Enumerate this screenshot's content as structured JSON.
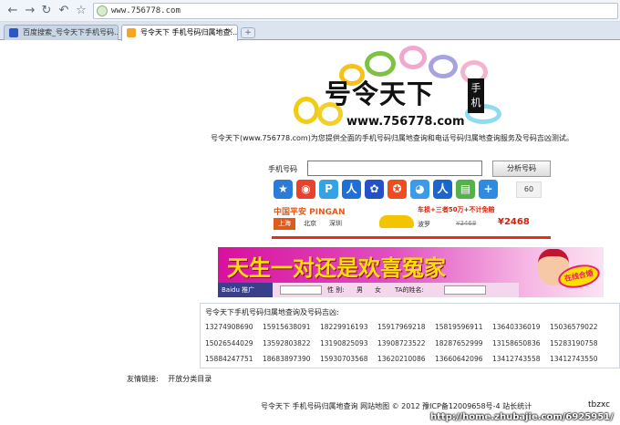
{
  "browser": {
    "url": "www.756778.com",
    "tabs": [
      {
        "title": "百度搜索_号令天下手机号码..."
      },
      {
        "title": "号令天下 手机号码归属地查..."
      }
    ],
    "icons": [
      "back-icon",
      "forward-icon",
      "reload-icon",
      "undo-icon",
      "star-icon",
      "close-icon",
      "new-tab-icon"
    ]
  },
  "logo": {
    "title": "号令天下",
    "sub": "手机",
    "domain": "www.756778.com"
  },
  "intro": "号令天下(www.756778.com)为您提供全面的手机号码归属地查询和电话号码归属地查询服务及号码吉凶测试。",
  "search": {
    "label": "手机号码",
    "value": "",
    "button": "分析号码"
  },
  "apps": {
    "icons": [
      "star-app-icon",
      "weibo-icon",
      "pps-icon",
      "renren-icon",
      "baidu-paw-icon",
      "game-icon",
      "qq-icon",
      "renren2-icon",
      "map-icon",
      "plus-icon"
    ],
    "count": "60"
  },
  "ad_pingan": {
    "brand": "中国平安 PINGAN",
    "cities": [
      "上海",
      "北京",
      "深圳"
    ],
    "offer": "车损+三者50万+不计免赔",
    "model": "波罗",
    "old_price": "¥3468",
    "new_price": "¥2468",
    "colors": {
      "brand": "#e05a1c",
      "price": "#d81e06"
    }
  },
  "ad_match": {
    "slogan": "天生一对还是欢喜冤家",
    "baidu": "Baidu 推广",
    "fields": [
      "性 别:",
      "男",
      "女",
      "TA的姓名:"
    ],
    "badge": "在线合婚"
  },
  "numbers_box": {
    "title": "号令天下手机号码归属地查询及号码吉凶:",
    "rows": [
      [
        "13274908690",
        "15915638091",
        "18229916193",
        "15917969218",
        "15819596911",
        "13640336019",
        "15036579022"
      ],
      [
        "15026544029",
        "13592803822",
        "13190825093",
        "13908723522",
        "18287652999",
        "13158650836",
        "15283190758"
      ],
      [
        "15884247751",
        "18683897390",
        "15930703568",
        "13620210086",
        "13660642096",
        "13412743558",
        "13412743550"
      ]
    ]
  },
  "friend_links": {
    "label": "友情链接:",
    "items": [
      "开放分类目录"
    ]
  },
  "footer": "号令天下 手机号码归属地查询  网站地图 © 2012 豫ICP备12009658号-4 站长统计",
  "watermark": {
    "text": "tbzxc",
    "url": "http://home.zhubajie.com/6925951/"
  }
}
